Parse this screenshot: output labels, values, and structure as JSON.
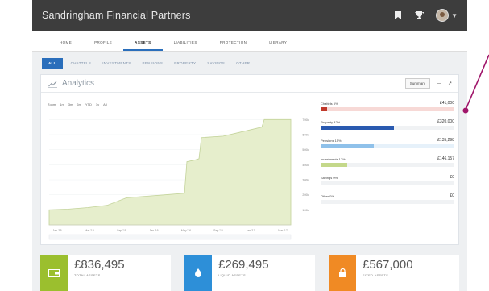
{
  "app": {
    "brand": "Sandringham Financial Partners"
  },
  "nav": {
    "tabs": [
      {
        "label": "HOME"
      },
      {
        "label": "PROFILE"
      },
      {
        "label": "ASSETS"
      },
      {
        "label": "LIABILITIES"
      },
      {
        "label": "PROTECTION"
      },
      {
        "label": "LIBRARY"
      }
    ],
    "active_index": 2
  },
  "subnav": {
    "items": [
      {
        "label": "ALL"
      },
      {
        "label": "CHATTELS"
      },
      {
        "label": "INVESTMENTS"
      },
      {
        "label": "PENSIONS"
      },
      {
        "label": "PROPERTY"
      },
      {
        "label": "SAVINGS"
      },
      {
        "label": "OTHER"
      }
    ],
    "active_index": 0
  },
  "panel": {
    "title": "Analytics",
    "summary_label": "Summary",
    "ctrl_label": "—",
    "range": [
      "Zoom",
      "1m",
      "3m",
      "6m",
      "YTD",
      "1y",
      "All"
    ]
  },
  "chart_data": {
    "type": "area",
    "color": "#e6eecc",
    "line_color": "#c3d39a",
    "x_labels": [
      "Jan '15",
      "Mar '15",
      "Sep '15",
      "Jan '16",
      "May '16",
      "Sep '16",
      "Jan '17",
      "Mar '17"
    ],
    "y_labels": [
      "100k",
      "200k",
      "300k",
      "400k",
      "500k",
      "600k",
      "700k"
    ],
    "series": [
      {
        "x": [
          0,
          0.08,
          0.16,
          0.24,
          0.32,
          0.4,
          0.48,
          0.56,
          0.57,
          0.6,
          0.62,
          0.63,
          0.72,
          0.8,
          0.88,
          0.89,
          0.94,
          1.0
        ],
        "y": [
          100,
          105,
          115,
          130,
          180,
          190,
          200,
          210,
          420,
          430,
          440,
          580,
          590,
          620,
          650,
          700,
          700,
          700
        ]
      }
    ]
  },
  "breakdown": [
    {
      "label": "Chattels 5%",
      "value": "£41,000",
      "fill": 0.05,
      "color": "#c0392b",
      "track": "#f7d9d6"
    },
    {
      "label": "Property 42%",
      "value": "£320,000",
      "fill": 0.55,
      "color": "#2a5ab0",
      "track": "#f0f2f4"
    },
    {
      "label": "Pensions 15%",
      "value": "£135,298",
      "fill": 0.4,
      "color": "#8fc1ea",
      "track": "#e6f1fa"
    },
    {
      "label": "Investments 17%",
      "value": "£146,157",
      "fill": 0.2,
      "color": "#c4d88a",
      "track": "#f0f2f4"
    },
    {
      "label": "Savings 0%",
      "value": "£0",
      "fill": 0,
      "color": "#999999",
      "track": "#f0f2f4"
    },
    {
      "label": "Other 0%",
      "value": "£0",
      "fill": 0,
      "color": "#999999",
      "track": "#f0f2f4"
    }
  ],
  "stats": [
    {
      "value": "£836,495",
      "label": "TOTAL ASSETS",
      "color": "#9bbf2e",
      "icon": "wallet-icon"
    },
    {
      "value": "£269,495",
      "label": "LIQUID ASSETS",
      "color": "#2d8fd8",
      "icon": "drop-icon"
    },
    {
      "value": "£567,000",
      "label": "FIXED ASSETS",
      "color": "#f08a24",
      "icon": "lock-icon"
    }
  ],
  "annotation_color": "#a0166a"
}
